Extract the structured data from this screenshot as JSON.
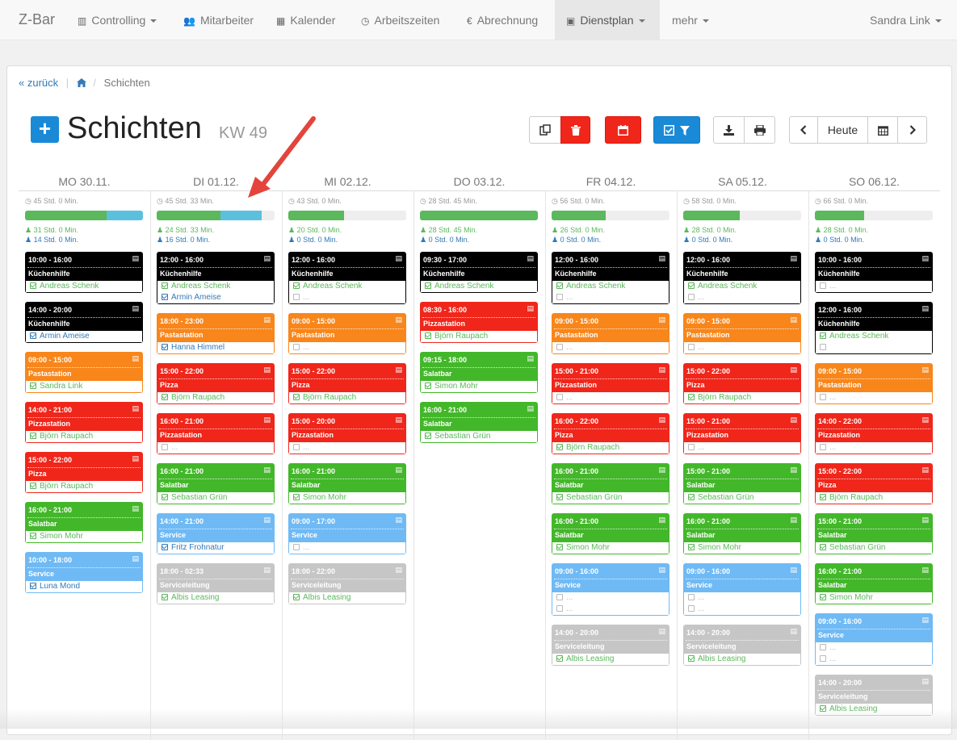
{
  "nav": {
    "brand": "Z-Bar",
    "items": [
      {
        "label": "Controlling",
        "icon": "bar-chart-icon",
        "glyph": "▥"
      },
      {
        "label": "Mitarbeiter",
        "icon": "users-icon",
        "glyph": "👥"
      },
      {
        "label": "Kalender",
        "icon": "calendar-icon",
        "glyph": "▦"
      },
      {
        "label": "Arbeitszeiten",
        "icon": "clock-icon",
        "glyph": "◷"
      },
      {
        "label": "Abrechnung",
        "icon": "euro-icon",
        "glyph": "€"
      },
      {
        "label": "Dienstplan",
        "icon": "calendar-check-icon",
        "glyph": "▣"
      },
      {
        "label": "mehr"
      }
    ],
    "user": "Sandra Link"
  },
  "breadcrumb": {
    "back": "zurück",
    "current": "Schichten"
  },
  "header": {
    "title": "Schichten",
    "week": "KW 49"
  },
  "toolbar": {
    "today_label": "Heute"
  },
  "colors": {
    "black": "#000000",
    "orange": "#f8861b",
    "red": "#f0261b",
    "green": "#43b72a",
    "lightblue": "#6fbaf5",
    "gray": "#c6c6c6"
  },
  "days": [
    {
      "label": "MO 30.11.",
      "total": "45 Std. 0 Min.",
      "green_frac": 0.69,
      "blue_frac": 0.31,
      "a": "31 Std. 0 Min.",
      "b": "14 Std. 0 Min.",
      "shifts": [
        {
          "time": "10:00 - 16:00",
          "name": "Küchenhilfe",
          "color": "black",
          "rows": [
            {
              "n": "Andreas Schenk",
              "c": "g"
            }
          ]
        },
        {
          "time": "14:00 - 20:00",
          "name": "Küchenhilfe",
          "color": "black",
          "rows": [
            {
              "n": "Armin Ameise",
              "c": "b"
            }
          ]
        },
        {
          "time": "09:00 - 15:00",
          "name": "Pastastation",
          "color": "orange",
          "rows": [
            {
              "n": "Sandra Link",
              "c": "g"
            }
          ]
        },
        {
          "time": "14:00 - 21:00",
          "name": "Pizzastation",
          "color": "red",
          "rows": [
            {
              "n": "Björn Raupach",
              "c": "g"
            }
          ]
        },
        {
          "time": "15:00 - 22:00",
          "name": "Pizza",
          "color": "red",
          "rows": [
            {
              "n": "Björn Raupach",
              "c": "g"
            }
          ]
        },
        {
          "time": "16:00 - 21:00",
          "name": "Salatbar",
          "color": "green",
          "rows": [
            {
              "n": "Simon Mohr",
              "c": "g"
            }
          ]
        },
        {
          "time": "10:00 - 18:00",
          "name": "Service",
          "color": "lightblue",
          "rows": [
            {
              "n": "Luna Mond",
              "c": "b"
            }
          ]
        }
      ]
    },
    {
      "label": "DI 01.12.",
      "total": "45 Std. 33 Min.",
      "green_frac": 0.54,
      "blue_frac": 0.35,
      "a": "24 Std. 33 Min.",
      "b": "16 Std. 0 Min.",
      "shifts": [
        {
          "time": "12:00 - 16:00",
          "name": "Küchenhilfe",
          "color": "black",
          "rows": [
            {
              "n": "Andreas Schenk",
              "c": "g"
            },
            {
              "n": "Armin Ameise",
              "c": "b"
            }
          ]
        },
        {
          "time": "18:00 - 23:00",
          "name": "Pastastation",
          "color": "orange",
          "rows": [
            {
              "n": "Hanna Himmel",
              "c": "b"
            }
          ]
        },
        {
          "time": "15:00 - 22:00",
          "name": "Pizza",
          "color": "red",
          "rows": [
            {
              "n": "Björn Raupach",
              "c": "g"
            }
          ]
        },
        {
          "time": "16:00 - 21:00",
          "name": "Pizzastation",
          "color": "red",
          "rows": [
            {
              "n": "...",
              "c": "e"
            }
          ]
        },
        {
          "time": "16:00 - 21:00",
          "name": "Salatbar",
          "color": "green",
          "rows": [
            {
              "n": "Sebastian Grün",
              "c": "g"
            }
          ]
        },
        {
          "time": "14:00 - 21:00",
          "name": "Service",
          "color": "lightblue",
          "rows": [
            {
              "n": "Fritz Frohnatur",
              "c": "b"
            }
          ]
        },
        {
          "time": "18:00 - 02:33",
          "name": "Serviceleitung",
          "color": "gray",
          "rows": [
            {
              "n": "Albis Leasing",
              "c": "g"
            }
          ]
        }
      ]
    },
    {
      "label": "MI 02.12.",
      "total": "43 Std. 0 Min.",
      "green_frac": 0.47,
      "blue_frac": 0,
      "a": "20 Std. 0 Min.",
      "b": "0 Std. 0 Min.",
      "shifts": [
        {
          "time": "12:00 - 16:00",
          "name": "Küchenhilfe",
          "color": "black",
          "rows": [
            {
              "n": "Andreas Schenk",
              "c": "g"
            },
            {
              "n": "...",
              "c": "e"
            }
          ]
        },
        {
          "time": "09:00 - 15:00",
          "name": "Pastastation",
          "color": "orange",
          "rows": [
            {
              "n": "...",
              "c": "e"
            }
          ]
        },
        {
          "time": "15:00 - 22:00",
          "name": "Pizza",
          "color": "red",
          "rows": [
            {
              "n": "Björn Raupach",
              "c": "g"
            }
          ]
        },
        {
          "time": "15:00 - 20:00",
          "name": "Pizzastation",
          "color": "red",
          "rows": [
            {
              "n": "...",
              "c": "e"
            }
          ]
        },
        {
          "time": "16:00 - 21:00",
          "name": "Salatbar",
          "color": "green",
          "rows": [
            {
              "n": "Simon Mohr",
              "c": "g"
            }
          ]
        },
        {
          "time": "09:00 - 17:00",
          "name": "Service",
          "color": "lightblue",
          "rows": [
            {
              "n": "...",
              "c": "e"
            }
          ]
        },
        {
          "time": "18:00 - 22:00",
          "name": "Serviceleitung",
          "color": "gray",
          "rows": [
            {
              "n": "Albis Leasing",
              "c": "g"
            }
          ]
        }
      ]
    },
    {
      "label": "DO 03.12.",
      "total": "28 Std. 45 Min.",
      "green_frac": 1.0,
      "blue_frac": 0,
      "a": "28 Std. 45 Min.",
      "b": "0 Std. 0 Min.",
      "shifts": [
        {
          "time": "09:30 - 17:00",
          "name": "Küchenhilfe",
          "color": "black",
          "rows": [
            {
              "n": "Andreas Schenk",
              "c": "g"
            }
          ]
        },
        {
          "time": "08:30 - 16:00",
          "name": "Pizzastation",
          "color": "red",
          "rows": [
            {
              "n": "Björn Raupach",
              "c": "g"
            }
          ]
        },
        {
          "time": "09:15 - 18:00",
          "name": "Salatbar",
          "color": "green",
          "rows": [
            {
              "n": "Simon Mohr",
              "c": "g"
            }
          ]
        },
        {
          "time": "16:00 - 21:00",
          "name": "Salatbar",
          "color": "green",
          "rows": [
            {
              "n": "Sebastian Grün",
              "c": "g"
            }
          ]
        }
      ]
    },
    {
      "label": "FR 04.12.",
      "total": "56 Std. 0 Min.",
      "green_frac": 0.46,
      "blue_frac": 0,
      "a": "26 Std. 0 Min.",
      "b": "0 Std. 0 Min.",
      "shifts": [
        {
          "time": "12:00 - 16:00",
          "name": "Küchenhilfe",
          "color": "black",
          "rows": [
            {
              "n": "Andreas Schenk",
              "c": "g"
            },
            {
              "n": "...",
              "c": "e"
            }
          ]
        },
        {
          "time": "09:00 - 15:00",
          "name": "Pastastation",
          "color": "orange",
          "rows": [
            {
              "n": "...",
              "c": "e"
            }
          ]
        },
        {
          "time": "15:00 - 21:00",
          "name": "Pizzastation",
          "color": "red",
          "rows": [
            {
              "n": "...",
              "c": "e"
            }
          ]
        },
        {
          "time": "16:00 - 22:00",
          "name": "Pizza",
          "color": "red",
          "rows": [
            {
              "n": "Björn Raupach",
              "c": "g"
            }
          ]
        },
        {
          "time": "16:00 - 21:00",
          "name": "Salatbar",
          "color": "green",
          "rows": [
            {
              "n": "Sebastian Grün",
              "c": "g"
            }
          ]
        },
        {
          "time": "16:00 - 21:00",
          "name": "Salatbar",
          "color": "green",
          "rows": [
            {
              "n": "Simon Mohr",
              "c": "g"
            }
          ]
        },
        {
          "time": "09:00 - 16:00",
          "name": "Service",
          "color": "lightblue",
          "rows": [
            {
              "n": "...",
              "c": "e"
            },
            {
              "n": "...",
              "c": "e"
            }
          ]
        },
        {
          "time": "14:00 - 20:00",
          "name": "Serviceleitung",
          "color": "gray",
          "rows": [
            {
              "n": "Albis Leasing",
              "c": "g"
            }
          ]
        }
      ]
    },
    {
      "label": "SA 05.12.",
      "total": "58 Std. 0 Min.",
      "green_frac": 0.48,
      "blue_frac": 0,
      "a": "28 Std. 0 Min.",
      "b": "0 Std. 0 Min.",
      "shifts": [
        {
          "time": "12:00 - 16:00",
          "name": "Küchenhilfe",
          "color": "black",
          "rows": [
            {
              "n": "Andreas Schenk",
              "c": "g"
            },
            {
              "n": "...",
              "c": "e"
            }
          ]
        },
        {
          "time": "09:00 - 15:00",
          "name": "Pastastation",
          "color": "orange",
          "rows": [
            {
              "n": "...",
              "c": "e"
            }
          ]
        },
        {
          "time": "15:00 - 22:00",
          "name": "Pizza",
          "color": "red",
          "rows": [
            {
              "n": "Björn Raupach",
              "c": "g"
            }
          ]
        },
        {
          "time": "15:00 - 21:00",
          "name": "Pizzastation",
          "color": "red",
          "rows": [
            {
              "n": "...",
              "c": "e"
            }
          ]
        },
        {
          "time": "15:00 - 21:00",
          "name": "Salatbar",
          "color": "green",
          "rows": [
            {
              "n": "Sebastian Grün",
              "c": "g"
            }
          ]
        },
        {
          "time": "16:00 - 21:00",
          "name": "Salatbar",
          "color": "green",
          "rows": [
            {
              "n": "Simon Mohr",
              "c": "g"
            }
          ]
        },
        {
          "time": "09:00 - 16:00",
          "name": "Service",
          "color": "lightblue",
          "rows": [
            {
              "n": "...",
              "c": "e"
            },
            {
              "n": "...",
              "c": "e"
            }
          ]
        },
        {
          "time": "14:00 - 20:00",
          "name": "Serviceleitung",
          "color": "gray",
          "rows": [
            {
              "n": "Albis Leasing",
              "c": "g"
            }
          ]
        }
      ]
    },
    {
      "label": "SO 06.12.",
      "total": "66 Std. 0 Min.",
      "green_frac": 0.42,
      "blue_frac": 0,
      "a": "28 Std. 0 Min.",
      "b": "0 Std. 0 Min.",
      "shifts": [
        {
          "time": "10:00 - 16:00",
          "name": "Küchenhilfe",
          "color": "black",
          "rows": [
            {
              "n": "...",
              "c": "e"
            }
          ]
        },
        {
          "time": "12:00 - 16:00",
          "name": "Küchenhilfe",
          "color": "black",
          "rows": [
            {
              "n": "Andreas Schenk",
              "c": "g"
            },
            {
              "n": "",
              "c": "e"
            }
          ]
        },
        {
          "time": "09:00 - 15:00",
          "name": "Pastastation",
          "color": "orange",
          "rows": [
            {
              "n": "...",
              "c": "e"
            }
          ]
        },
        {
          "time": "14:00 - 22:00",
          "name": "Pizzastation",
          "color": "red",
          "rows": [
            {
              "n": "...",
              "c": "e"
            }
          ]
        },
        {
          "time": "15:00 - 22:00",
          "name": "Pizza",
          "color": "red",
          "rows": [
            {
              "n": "Björn Raupach",
              "c": "g"
            }
          ]
        },
        {
          "time": "15:00 - 21:00",
          "name": "Salatbar",
          "color": "green",
          "rows": [
            {
              "n": "Sebastian Grün",
              "c": "g"
            }
          ]
        },
        {
          "time": "16:00 - 21:00",
          "name": "Salatbar",
          "color": "green",
          "rows": [
            {
              "n": "Simon Mohr",
              "c": "g"
            }
          ]
        },
        {
          "time": "09:00 - 16:00",
          "name": "Service",
          "color": "lightblue",
          "rows": [
            {
              "n": "...",
              "c": "e"
            },
            {
              "n": "...",
              "c": "e"
            }
          ]
        },
        {
          "time": "14:00 - 20:00",
          "name": "Serviceleitung",
          "color": "gray",
          "rows": [
            {
              "n": "Albis Leasing",
              "c": "g"
            }
          ]
        }
      ]
    }
  ]
}
